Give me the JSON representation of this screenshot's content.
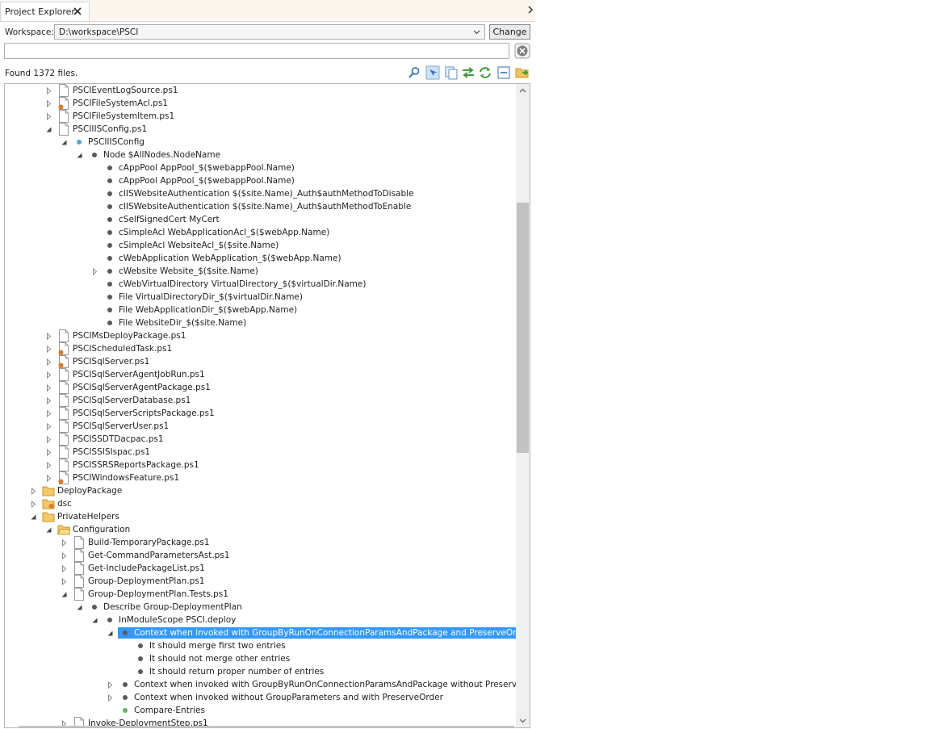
{
  "tab": {
    "title": "Project Explorer"
  },
  "workspace": {
    "label": "Workspace:",
    "value": "D:\\workspace\\PSCI",
    "change_label": "Change"
  },
  "search": {
    "value": ""
  },
  "status": {
    "found_text": "Found 1372 files."
  },
  "toolbar": {
    "icons": [
      "find-icon",
      "locate-icon",
      "copy-icon",
      "sync-icon",
      "refresh-icon",
      "collapse-all-icon",
      "open-folder-icon"
    ]
  },
  "colors": {
    "selection": "#3399ff",
    "node_bullet": "#5a5a5a",
    "config_bullet": "#4fa3e0",
    "ok_bullet": "#5cb85c",
    "error_badge": "#e07a2a",
    "folder": "#f5c86a"
  },
  "tree": {
    "rows": [
      {
        "label": "PSCIEventLogSource.ps1",
        "depth": 3,
        "icon": "file",
        "exp": "collapsed"
      },
      {
        "label": "PSCIFileSystemAcl.ps1",
        "depth": 3,
        "icon": "file-error",
        "exp": "collapsed"
      },
      {
        "label": "PSCIFileSystemItem.ps1",
        "depth": 3,
        "icon": "file",
        "exp": "collapsed"
      },
      {
        "label": "PSCIIISConfig.ps1",
        "depth": 3,
        "icon": "file",
        "exp": "expanded"
      },
      {
        "label": "PSCIIISConfig",
        "depth": 4,
        "icon": "bullet-config",
        "exp": "expanded"
      },
      {
        "label": "Node $AllNodes.NodeName",
        "depth": 5,
        "icon": "bullet",
        "exp": "expanded"
      },
      {
        "label": "cAppPool AppPool_$($webappPool.Name)",
        "depth": 6,
        "icon": "bullet",
        "exp": "none"
      },
      {
        "label": "cAppPool AppPool_$($webappPool.Name)",
        "depth": 6,
        "icon": "bullet",
        "exp": "none"
      },
      {
        "label": "cIISWebsiteAuthentication $($site.Name)_Auth$authMethodToDisable",
        "depth": 6,
        "icon": "bullet",
        "exp": "none"
      },
      {
        "label": "cIISWebsiteAuthentication $($site.Name)_Auth$authMethodToEnable",
        "depth": 6,
        "icon": "bullet",
        "exp": "none"
      },
      {
        "label": "cSelfSignedCert MyCert",
        "depth": 6,
        "icon": "bullet",
        "exp": "none"
      },
      {
        "label": "cSimpleAcl WebApplicationAcl_$($webApp.Name)",
        "depth": 6,
        "icon": "bullet",
        "exp": "none"
      },
      {
        "label": "cSimpleAcl WebsiteAcl_$($site.Name)",
        "depth": 6,
        "icon": "bullet",
        "exp": "none"
      },
      {
        "label": "cWebApplication WebApplication_$($webApp.Name)",
        "depth": 6,
        "icon": "bullet",
        "exp": "none"
      },
      {
        "label": "cWebsite Website_$($site.Name)",
        "depth": 6,
        "icon": "bullet",
        "exp": "collapsed"
      },
      {
        "label": "cWebVirtualDirectory VirtualDirectory_$($virtualDir.Name)",
        "depth": 6,
        "icon": "bullet",
        "exp": "none"
      },
      {
        "label": "File VirtualDirectoryDir_$($virtualDir.Name)",
        "depth": 6,
        "icon": "bullet",
        "exp": "none"
      },
      {
        "label": "File WebApplicationDir_$($webApp.Name)",
        "depth": 6,
        "icon": "bullet",
        "exp": "none"
      },
      {
        "label": "File WebsiteDir_$($site.Name)",
        "depth": 6,
        "icon": "bullet",
        "exp": "none"
      },
      {
        "label": "PSCIMsDeployPackage.ps1",
        "depth": 3,
        "icon": "file",
        "exp": "collapsed"
      },
      {
        "label": "PSCIScheduledTask.ps1",
        "depth": 3,
        "icon": "file-error",
        "exp": "collapsed"
      },
      {
        "label": "PSCISqlServer.ps1",
        "depth": 3,
        "icon": "file-error",
        "exp": "collapsed"
      },
      {
        "label": "PSCISqlServerAgentJobRun.ps1",
        "depth": 3,
        "icon": "file",
        "exp": "collapsed"
      },
      {
        "label": "PSCISqlServerAgentPackage.ps1",
        "depth": 3,
        "icon": "file",
        "exp": "collapsed"
      },
      {
        "label": "PSCISqlServerDatabase.ps1",
        "depth": 3,
        "icon": "file",
        "exp": "collapsed"
      },
      {
        "label": "PSCISqlServerScriptsPackage.ps1",
        "depth": 3,
        "icon": "file",
        "exp": "collapsed"
      },
      {
        "label": "PSCISqlServerUser.ps1",
        "depth": 3,
        "icon": "file",
        "exp": "collapsed"
      },
      {
        "label": "PSCISSDTDacpac.ps1",
        "depth": 3,
        "icon": "file",
        "exp": "collapsed"
      },
      {
        "label": "PSCISSISIspac.ps1",
        "depth": 3,
        "icon": "file",
        "exp": "collapsed"
      },
      {
        "label": "PSCISSRSReportsPackage.ps1",
        "depth": 3,
        "icon": "file",
        "exp": "collapsed"
      },
      {
        "label": "PSCIWindowsFeature.ps1",
        "depth": 3,
        "icon": "file-error",
        "exp": "collapsed"
      },
      {
        "label": "DeployPackage",
        "depth": 2,
        "icon": "folder",
        "exp": "collapsed"
      },
      {
        "label": "dsc",
        "depth": 2,
        "icon": "folder-error",
        "exp": "collapsed"
      },
      {
        "label": "PrivateHelpers",
        "depth": 2,
        "icon": "folder",
        "exp": "expanded"
      },
      {
        "label": "Configuration",
        "depth": 3,
        "icon": "folder-open",
        "exp": "expanded"
      },
      {
        "label": "Build-TemporaryPackage.ps1",
        "depth": 4,
        "icon": "file",
        "exp": "collapsed"
      },
      {
        "label": "Get-CommandParametersAst.ps1",
        "depth": 4,
        "icon": "file",
        "exp": "collapsed"
      },
      {
        "label": "Get-IncludePackageList.ps1",
        "depth": 4,
        "icon": "file",
        "exp": "collapsed"
      },
      {
        "label": "Group-DeploymentPlan.ps1",
        "depth": 4,
        "icon": "file",
        "exp": "collapsed"
      },
      {
        "label": "Group-DeploymentPlan.Tests.ps1",
        "depth": 4,
        "icon": "file",
        "exp": "expanded"
      },
      {
        "label": "Describe Group-DeploymentPlan",
        "depth": 5,
        "icon": "bullet",
        "exp": "expanded"
      },
      {
        "label": "InModuleScope PSCI.deploy",
        "depth": 6,
        "icon": "bullet",
        "exp": "expanded"
      },
      {
        "label": "Context when invoked with GroupByRunOnConnectionParamsAndPackage and PreserveOrder",
        "depth": 7,
        "icon": "bullet",
        "exp": "expanded",
        "selected": true
      },
      {
        "label": "It should merge first two entries",
        "depth": 8,
        "icon": "bullet",
        "exp": "none"
      },
      {
        "label": "It should not merge other entries",
        "depth": 8,
        "icon": "bullet",
        "exp": "none"
      },
      {
        "label": "It should return proper number of entries",
        "depth": 8,
        "icon": "bullet",
        "exp": "none"
      },
      {
        "label": "Context when invoked with GroupByRunOnConnectionParamsAndPackage without PreserveOrder",
        "depth": 7,
        "icon": "bullet",
        "exp": "collapsed"
      },
      {
        "label": "Context when invoked without GroupParameters and with PreserveOrder",
        "depth": 7,
        "icon": "bullet",
        "exp": "collapsed"
      },
      {
        "label": "Compare-Entries",
        "depth": 7,
        "icon": "bullet-ok",
        "exp": "none"
      },
      {
        "label": "Invoke-DeploymentStep.ps1",
        "depth": 4,
        "icon": "file",
        "exp": "collapsed"
      }
    ]
  }
}
